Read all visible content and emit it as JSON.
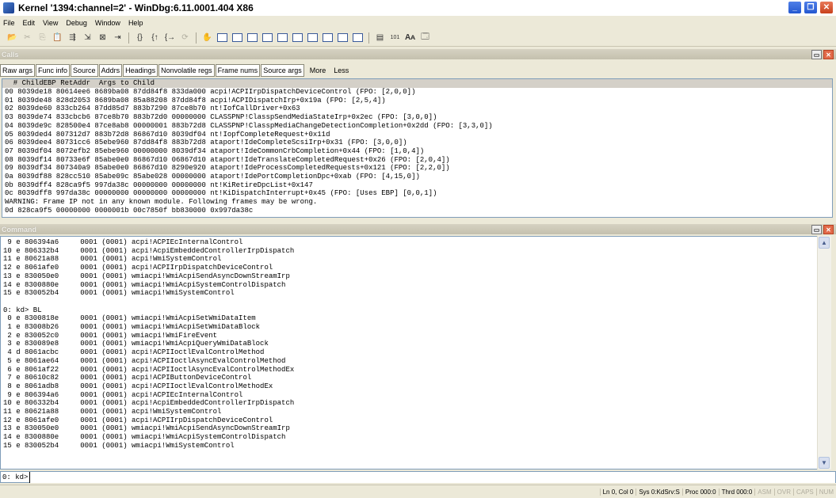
{
  "window": {
    "title": "Kernel '1394:channel=2' - WinDbg:6.11.0001.404 X86"
  },
  "menu": [
    "File",
    "Edit",
    "View",
    "Debug",
    "Window",
    "Help"
  ],
  "toolbar_icons": [
    "open-icon",
    "cut-icon",
    "copy-icon",
    "paste-icon",
    "step-icon",
    "step-into-icon",
    "break-icon",
    "go-icon",
    "step-over-icon",
    "step-out-icon",
    "run-to-cursor-icon",
    "breakpoint-icon",
    "command-window-icon",
    "watch-icon",
    "locals-icon",
    "registers-icon",
    "memory-icon",
    "call-stack-icon",
    "disassembly-icon",
    "scratch-icon",
    "process-icon",
    "source-mode-icon",
    "hex-icon",
    "font-icon",
    "options-icon"
  ],
  "calls": {
    "title": "Calls",
    "buttons": [
      "Raw args",
      "Func info",
      "Source",
      "Addrs",
      "Headings",
      "Nonvolatile regs",
      "Frame nums",
      "Source args"
    ],
    "more": "More",
    "less": "Less",
    "header": "  # ChildEBP RetAddr  Args to Child",
    "lines": [
      "00 8039de18 80614ee6 8689ba08 87dd84f8 833da000 acpi!ACPIIrpDispatchDeviceControl (FPO: [2,0,0])",
      "01 8039de48 828d2053 8689ba08 85a88208 87dd84f8 acpi!ACPIDispatchIrp+0x19a (FPO: [2,5,4])",
      "02 8039de60 833cb264 87dd85d7 883b7290 87ce8b70 nt!IofCallDriver+0x63",
      "03 8039de74 833cbcb6 87ce8b70 883b72d0 00000000 CLASSPNP!ClasspSendMediaStateIrp+0x2ec (FPO: [3,0,0])",
      "04 8039de9c 828500e4 87ce8ab8 00000001 883b72d8 CLASSPNP!ClasspMediaChangeDetectionCompletion+0x2dd (FPO: [3,3,0])",
      "05 8039ded4 807312d7 883b72d8 86867d10 8039df04 nt!IopfCompleteRequest+0x11d",
      "06 8039dee4 80731cc6 85ebe960 87dd84f8 883b72d8 ataport!IdeCompleteScsiIrp+0x31 (FPO: [3,0,0])",
      "07 8039df04 8072efb2 85ebe960 00000000 8039df34 ataport!IdeCommonCrbCompletion+0x44 (FPO: [1,0,4])",
      "08 8039df14 80733e6f 85abe0e0 86867d10 06867d10 ataport!IdeTranslateCompletedRequest+0x26 (FPO: [2,0,4])",
      "09 8039df34 807340a9 85abe0e0 86867d10 8290e920 ataport!IdeProcessCompletedRequests+0x121 (FPO: [2,2,0])",
      "0a 8039df88 828cc510 85abe09c 85abe028 00000000 ataport!IdePortCompletionDpc+0xab (FPO: [4,15,0])",
      "0b 8039dff4 828ca9f5 997da38c 00000000 00000000 nt!KiRetireDpcList+0x147",
      "0c 8039dff8 997da38c 00000000 00000000 00000000 nt!KiDispatchInterrupt+0x45 (FPO: [Uses EBP] [0,0,1])",
      "WARNING: Frame IP not in any known module. Following frames may be wrong.",
      "0d 828ca9f5 00000000 0000001b 00c7850f bb830000 0x997da38c"
    ]
  },
  "command": {
    "title": "Command",
    "lines": [
      " 9 e 806394a6     0001 (0001) acpi!ACPIEcInternalControl",
      "10 e 806332b4     0001 (0001) acpi!AcpiEmbeddedControllerIrpDispatch",
      "11 e 80621a88     0001 (0001) acpi!WmiSystemControl",
      "12 e 8061afe0     0001 (0001) acpi!ACPIIrpDispatchDeviceControl",
      "13 e 830050e0     0001 (0001) wmiacpi!WmiAcpiSendAsyncDownStreamIrp",
      "14 e 8300880e     0001 (0001) wmiacpi!WmiAcpiSystemControlDispatch",
      "15 e 830052b4     0001 (0001) wmiacpi!WmiSystemControl",
      "",
      "0: kd> BL",
      " 0 e 8300818e     0001 (0001) wmiacpi!WmiAcpiSetWmiDataItem",
      " 1 e 83008b26     0001 (0001) wmiacpi!WmiAcpiSetWmiDataBlock",
      " 2 e 830052c0     0001 (0001) wmiacpi!WmiFireEvent",
      " 3 e 830089e8     0001 (0001) wmiacpi!WmiAcpiQueryWmiDataBlock",
      " 4 d 8061acbc     0001 (0001) acpi!ACPIIoctlEvalControlMethod",
      " 5 e 8061ae64     0001 (0001) acpi!ACPIIoctlAsyncEvalControlMethod",
      " 6 e 8061af22     0001 (0001) acpi!ACPIIoctlAsyncEvalControlMethodEx",
      " 7 e 80610c82     0001 (0001) acpi!ACPIButtonDeviceControl",
      " 8 e 8061adb8     0001 (0001) acpi!ACPIIoctlEvalControlMethodEx",
      " 9 e 806394a6     0001 (0001) acpi!ACPIEcInternalControl",
      "10 e 806332b4     0001 (0001) acpi!AcpiEmbeddedControllerIrpDispatch",
      "11 e 80621a88     0001 (0001) acpi!WmiSystemControl",
      "12 e 8061afe0     0001 (0001) acpi!ACPIIrpDispatchDeviceControl",
      "13 e 830050e0     0001 (0001) wmiacpi!WmiAcpiSendAsyncDownStreamIrp",
      "14 e 8300880e     0001 (0001) wmiacpi!WmiAcpiSystemControlDispatch",
      "15 e 830052b4     0001 (0001) wmiacpi!WmiSystemControl"
    ],
    "prompt": "0: kd>",
    "input_value": ""
  },
  "status": {
    "items": [
      "Ln 0, Col 0",
      "Sys 0:KdSrv:S",
      "Proc 000:0",
      "Thrd 000:0"
    ],
    "dim_items": [
      "ASM",
      "OVR",
      "CAPS",
      "NUM"
    ]
  },
  "colors": {
    "title_bar": "#ffffff",
    "chrome": "#ece9d8",
    "pane_header": "#c4c0ae",
    "close_button": "#c8401c"
  }
}
